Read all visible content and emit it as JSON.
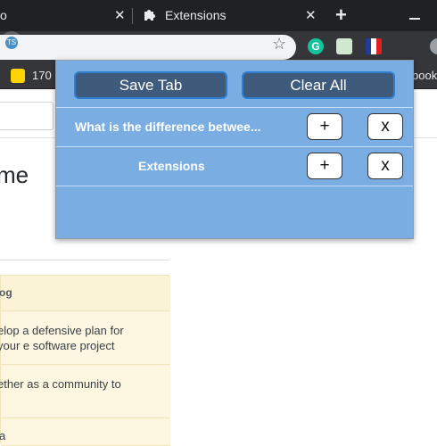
{
  "browser": {
    "tabs": [
      {
        "label": "o",
        "close": "✕"
      },
      {
        "label": "Extensions",
        "close": "✕"
      }
    ],
    "new_tab": "+",
    "toolbar": {
      "extensions": [
        {
          "name": "grammarly",
          "glyph": "G"
        },
        {
          "name": "checklist"
        },
        {
          "name": "flag"
        },
        {
          "name": "tab-saver",
          "glyph": "TS"
        },
        {
          "name": "profile"
        }
      ]
    },
    "bookmarks": [
      {
        "label": "170"
      },
      {
        "label": "book"
      }
    ]
  },
  "page": {
    "heading": "me",
    "blog": {
      "header": "og",
      "items": [
        "elop a defensive plan for your e software project",
        "ether as a community to",
        "a"
      ]
    }
  },
  "popup": {
    "save_label": "Save Tab",
    "clear_label": "Clear All",
    "rows": [
      {
        "title": "What is the difference betwee...",
        "plus": "+",
        "remove": "x"
      },
      {
        "title": "Extensions",
        "plus": "+",
        "remove": "x"
      }
    ]
  },
  "colors": {
    "popup_bg": "#7aaee3",
    "button_bg": "#3e5b7c",
    "button_border": "#2f7fd0",
    "chrome_dark": "#202124",
    "toolbar": "#35363a"
  }
}
